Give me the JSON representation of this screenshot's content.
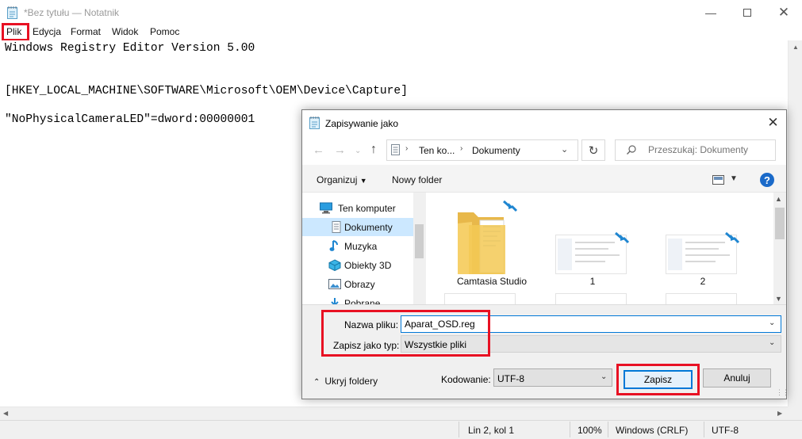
{
  "notepad": {
    "title": "*Bez tytułu — Notatnik",
    "menu": [
      "Plik",
      "Edycja",
      "Format",
      "Widok",
      "Pomoc"
    ],
    "lines": [
      "Windows Registry Editor Version 5.00",
      "",
      "[HKEY_LOCAL_MACHINE\\SOFTWARE\\Microsoft\\OEM\\Device\\Capture]",
      "",
      "\"NoPhysicalCameraLED\"=dword:00000001"
    ],
    "status": {
      "position": "Lin 2, kol 1",
      "zoom": "100%",
      "line_ending": "Windows (CRLF)",
      "encoding": "UTF-8"
    }
  },
  "dialog": {
    "title": "Zapisywanie jako",
    "breadcrumb": [
      "Ten ko...",
      "Dokumenty"
    ],
    "search_placeholder": "Przeszukaj: Dokumenty",
    "toolbar": {
      "organize": "Organizuj",
      "new_folder": "Nowy folder"
    },
    "tree": [
      {
        "label": "Ten komputer",
        "icon": "computer-icon"
      },
      {
        "label": "Dokumenty",
        "icon": "documents-icon",
        "selected": true
      },
      {
        "label": "Muzyka",
        "icon": "music-icon"
      },
      {
        "label": "Obiekty 3D",
        "icon": "3d-objects-icon"
      },
      {
        "label": "Obrazy",
        "icon": "pictures-icon"
      },
      {
        "label": "Pobrane",
        "icon": "downloads-icon"
      }
    ],
    "files": [
      {
        "name": "Camtasia Studio",
        "type": "folder"
      },
      {
        "name": "1",
        "type": "image"
      },
      {
        "name": "2",
        "type": "image"
      }
    ],
    "filename_label": "Nazwa pliku:",
    "filename": "Aparat_OSD.reg",
    "filetype_label": "Zapisz jako typ:",
    "filetype": "Wszystkie pliki",
    "hide_folders": "Ukryj foldery",
    "encoding_label": "Kodowanie:",
    "encoding": "UTF-8",
    "save": "Zapisz",
    "cancel": "Anuluj"
  },
  "colors": {
    "highlight": "#e81123",
    "accent": "#0078d7",
    "selection": "#cce8ff"
  }
}
